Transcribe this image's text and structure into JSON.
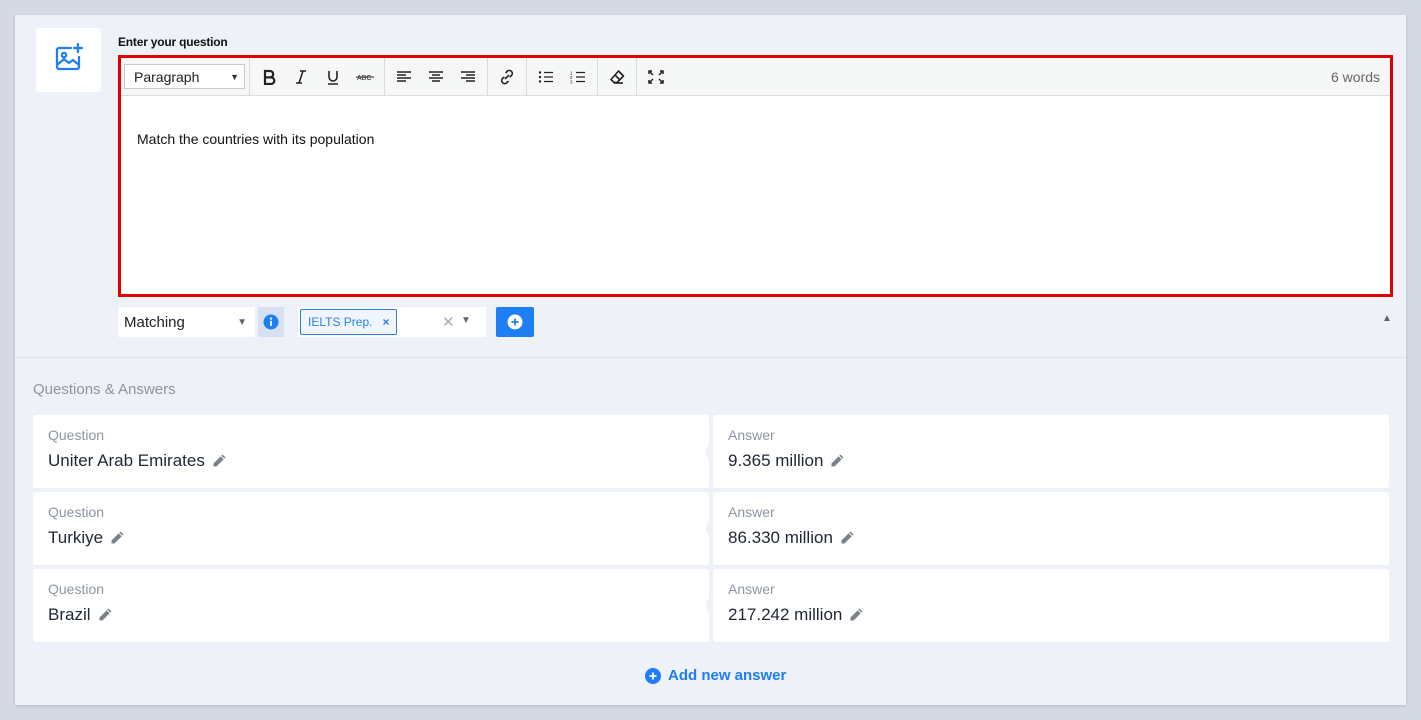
{
  "editor": {
    "label": "Enter your question",
    "block_format": "Paragraph",
    "word_count": "6 words",
    "content": "Match the countries with its population"
  },
  "controls": {
    "type_value": "Matching",
    "tag_label": "IELTS Prep.",
    "tag_remove": "×"
  },
  "qa": {
    "title": "Questions & Answers",
    "question_label": "Question",
    "answer_label": "Answer",
    "pairs": [
      {
        "question": "Uniter Arab Emirates",
        "answer": "9.365 million"
      },
      {
        "question": "Turkiye",
        "answer": "86.330 million"
      },
      {
        "question": "Brazil",
        "answer": "217.242 million"
      }
    ],
    "add_label": "Add new answer"
  },
  "colors": {
    "accent": "#1e7ef3",
    "highlight_border": "#e00000",
    "background": "#eef1f7"
  },
  "icons": [
    "add-image-icon",
    "bold-icon",
    "italic-icon",
    "underline-icon",
    "strikethrough-icon",
    "align-left-icon",
    "align-center-icon",
    "align-right-icon",
    "link-icon",
    "bullet-list-icon",
    "numbered-list-icon",
    "clear-format-icon",
    "fullscreen-icon",
    "info-icon",
    "plus-circle-icon",
    "pencil-icon",
    "chevron-up-icon"
  ]
}
